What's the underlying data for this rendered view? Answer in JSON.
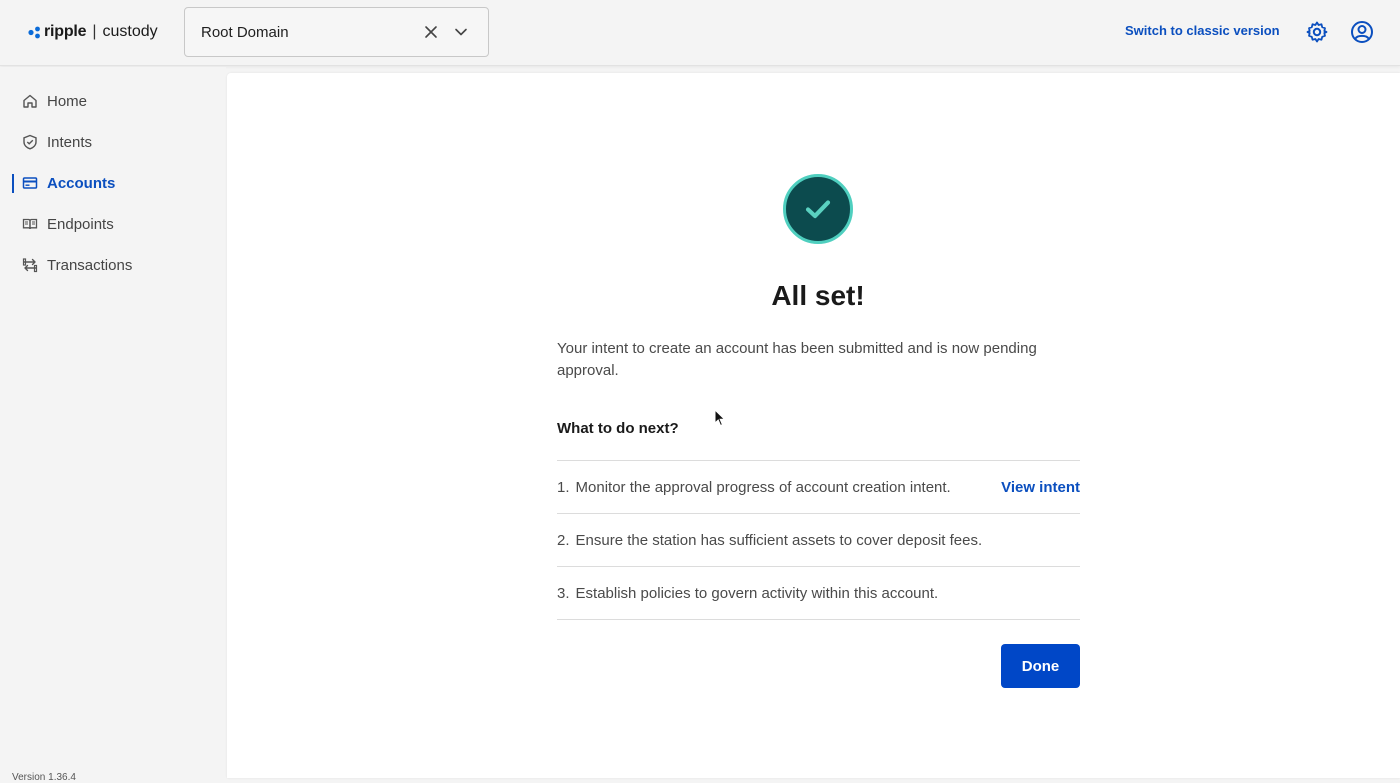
{
  "header": {
    "logo_brand": "ripple",
    "logo_separator": "|",
    "logo_product": "custody",
    "domain_select": {
      "value": "Root Domain"
    },
    "switch_link": "Switch to classic version",
    "icons": {
      "settings": "gear-icon",
      "profile": "user-circle-icon",
      "clear": "close-icon",
      "dropdown": "chevron-down-icon"
    }
  },
  "sidebar": {
    "items": [
      {
        "label": "Home",
        "icon": "home-icon",
        "active": false
      },
      {
        "label": "Intents",
        "icon": "shield-icon",
        "active": false
      },
      {
        "label": "Accounts",
        "icon": "card-icon",
        "active": true
      },
      {
        "label": "Endpoints",
        "icon": "book-icon",
        "active": false
      },
      {
        "label": "Transactions",
        "icon": "transfer-icon",
        "active": false
      }
    ],
    "version": "Version 1.36.4"
  },
  "main": {
    "title": "All set!",
    "message": "Your intent to create an account has been submitted and is now pending approval.",
    "next_heading": "What to do next?",
    "steps": [
      {
        "num": "1.",
        "text": "Monitor the approval progress of account creation intent.",
        "link": "View intent"
      },
      {
        "num": "2.",
        "text": "Ensure the station has sufficient assets to cover deposit fees."
      },
      {
        "num": "3.",
        "text": "Establish policies to govern activity within this account."
      }
    ],
    "done_label": "Done"
  },
  "colors": {
    "accent": "#0b4fbf",
    "button": "#0047c7",
    "success_fill": "#0c4b4e",
    "success_ring": "#4fcfbf"
  }
}
